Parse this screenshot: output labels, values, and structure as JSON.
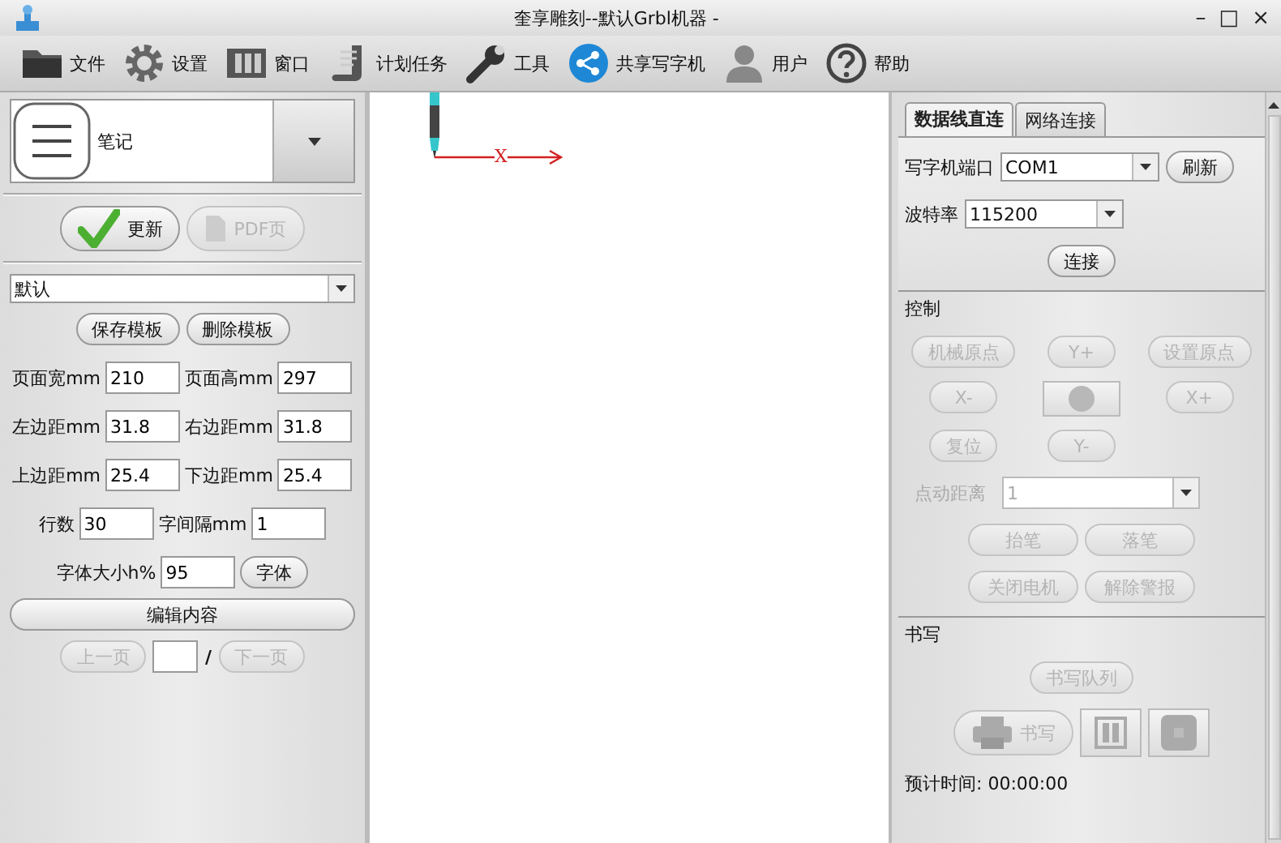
{
  "window": {
    "title": "奎享雕刻--默认Grbl机器 -",
    "controls": [
      "–",
      "□",
      "×"
    ]
  },
  "toolbar": [
    {
      "label": "文件"
    },
    {
      "label": "设置"
    },
    {
      "label": "窗口"
    },
    {
      "label": "计划任务"
    },
    {
      "label": "工具"
    },
    {
      "label": "共享写字机"
    },
    {
      "label": "用户"
    },
    {
      "label": "帮助"
    }
  ],
  "left": {
    "selector": {
      "label": "笔记"
    },
    "actions": [
      {
        "label": "更新",
        "disabled": false
      },
      {
        "label": "PDF页",
        "disabled": true
      }
    ],
    "template": {
      "value": "默认"
    },
    "template_buttons": [
      "保存模板",
      "删除模板"
    ],
    "field_rows": [
      [
        {
          "kind": "field",
          "label": "页面宽mm",
          "value": "210"
        },
        {
          "kind": "field",
          "label": "页面高mm",
          "value": "297"
        }
      ],
      [
        {
          "kind": "field",
          "label": "左边距mm",
          "value": "31.8"
        },
        {
          "kind": "field",
          "label": "右边距mm",
          "value": "31.8"
        }
      ],
      [
        {
          "kind": "field",
          "label": "上边距mm",
          "value": "25.4"
        },
        {
          "kind": "field",
          "label": "下边距mm",
          "value": "25.4"
        }
      ],
      [
        {
          "kind": "field",
          "label": "行数",
          "value": "30"
        },
        {
          "kind": "field",
          "label": "字间隔mm",
          "value": "1"
        }
      ],
      [
        {
          "kind": "field",
          "label": "字体大小h%",
          "value": "95"
        },
        {
          "kind": "button",
          "label": "字体"
        }
      ]
    ],
    "edit_button": "编辑内容",
    "pager": {
      "prev": {
        "label": "上一页",
        "disabled": true
      },
      "separator": "/",
      "next": {
        "label": "下一页",
        "disabled": true
      }
    }
  },
  "canvas": {
    "axis_label": "X"
  },
  "right": {
    "tabs": [
      {
        "label": "数据线直连",
        "selected": true
      },
      {
        "label": "网络连接",
        "selected": false
      }
    ],
    "port": {
      "label": "写字机端口",
      "value": "COM1",
      "button": "刷新"
    },
    "baud": {
      "label": "波特率",
      "value": "115200"
    },
    "connect_button": "连接",
    "control": {
      "title": "控制",
      "rows": [
        [
          {
            "kind": "text",
            "label": "机械原点",
            "disabled": true
          },
          {
            "kind": "text",
            "label": "Y+",
            "disabled": true
          },
          {
            "kind": "text",
            "label": "设置原点",
            "disabled": true
          }
        ],
        [
          {
            "kind": "text",
            "label": "X-",
            "disabled": true
          },
          {
            "kind": "circle",
            "disabled": true
          },
          {
            "kind": "text",
            "label": "X+",
            "disabled": true
          }
        ],
        [
          {
            "kind": "text",
            "label": "复位",
            "disabled": true
          },
          {
            "kind": "text",
            "label": "Y-",
            "disabled": true
          }
        ]
      ],
      "jog": {
        "label": "点动距离",
        "value": "1",
        "disabled": true
      },
      "pen_buttons": [
        [
          {
            "label": "抬笔",
            "disabled": true
          },
          {
            "label": "落笔",
            "disabled": true
          }
        ],
        [
          {
            "label": "关闭电机",
            "disabled": true
          },
          {
            "label": "解除警报",
            "disabled": true
          }
        ]
      ]
    },
    "writing": {
      "title": "书写",
      "queue_button": {
        "label": "书写队列",
        "disabled": true
      },
      "write_button": {
        "label": "书写",
        "disabled": true
      },
      "icon_buttons": [
        {
          "kind": "pause",
          "disabled": true
        },
        {
          "kind": "stop",
          "disabled": true
        }
      ],
      "time": "预计时间: 00:00:00"
    }
  }
}
